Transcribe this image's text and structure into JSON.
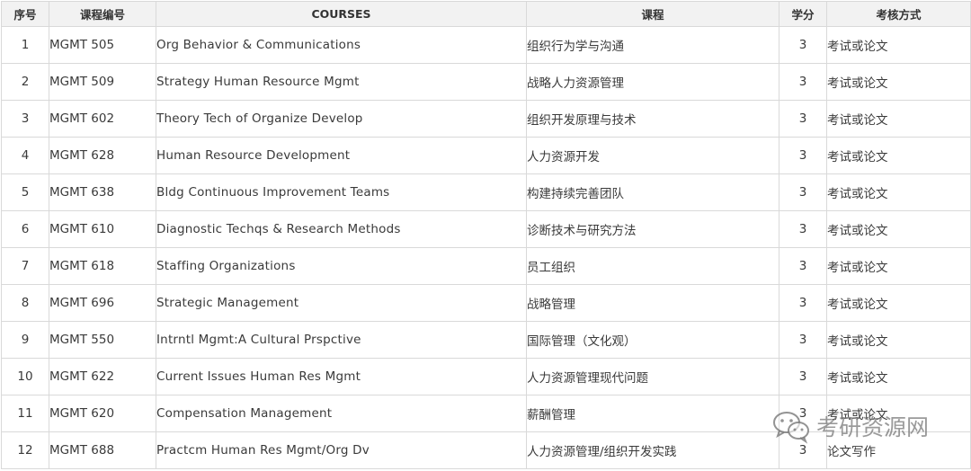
{
  "table": {
    "headers": {
      "no": "序号",
      "code": "课程编号",
      "course_en": "COURSES",
      "course_zh": "课程",
      "credits": "学分",
      "assessment": "考核方式"
    },
    "rows": [
      {
        "no": "1",
        "code": "MGMT 505",
        "course_en": "Org Behavior & Communications",
        "course_zh": "组织行为学与沟通",
        "credits": "3",
        "assessment": "考试或论文"
      },
      {
        "no": "2",
        "code": "MGMT 509",
        "course_en": "Strategy Human Resource Mgmt",
        "course_zh": "战略人力资源管理",
        "credits": "3",
        "assessment": "考试或论文"
      },
      {
        "no": "3",
        "code": "MGMT 602",
        "course_en": "Theory Tech of Organize Develop",
        "course_zh": "组织开发原理与技术",
        "credits": "3",
        "assessment": "考试或论文"
      },
      {
        "no": "4",
        "code": "MGMT 628",
        "course_en": "Human Resource Development",
        "course_zh": "人力资源开发",
        "credits": "3",
        "assessment": "考试或论文"
      },
      {
        "no": "5",
        "code": "MGMT 638",
        "course_en": "Bldg Continuous Improvement Teams",
        "course_zh": "构建持续完善团队",
        "credits": "3",
        "assessment": "考试或论文"
      },
      {
        "no": "6",
        "code": "MGMT 610",
        "course_en": "Diagnostic Techqs & Research Methods",
        "course_zh": "诊断技术与研究方法",
        "credits": "3",
        "assessment": "考试或论文"
      },
      {
        "no": "7",
        "code": "MGMT 618",
        "course_en": "Staffing Organizations",
        "course_zh": "员工组织",
        "credits": "3",
        "assessment": "考试或论文"
      },
      {
        "no": "8",
        "code": "MGMT 696",
        "course_en": "Strategic Management",
        "course_zh": "战略管理",
        "credits": "3",
        "assessment": "考试或论文"
      },
      {
        "no": "9",
        "code": "MGMT 550",
        "course_en": "Intrntl Mgmt:A Cultural Prspctive",
        "course_zh": "国际管理（文化观）",
        "credits": "3",
        "assessment": "考试或论文"
      },
      {
        "no": "10",
        "code": "MGMT 622",
        "course_en": "Current Issues Human Res Mgmt",
        "course_zh": "人力资源管理现代问题",
        "credits": "3",
        "assessment": "考试或论文"
      },
      {
        "no": "11",
        "code": "MGMT 620",
        "course_en": "Compensation Management",
        "course_zh": "薪酬管理",
        "credits": "3",
        "assessment": "考试或论文"
      },
      {
        "no": "12",
        "code": "MGMT 688",
        "course_en": "Practcm Human Res Mgmt/Org Dv",
        "course_zh": "人力资源管理/组织开发实践",
        "credits": "3",
        "assessment": "论文写作"
      }
    ]
  },
  "watermark": {
    "text": "考研资源网",
    "icon": "wechat-icon"
  }
}
